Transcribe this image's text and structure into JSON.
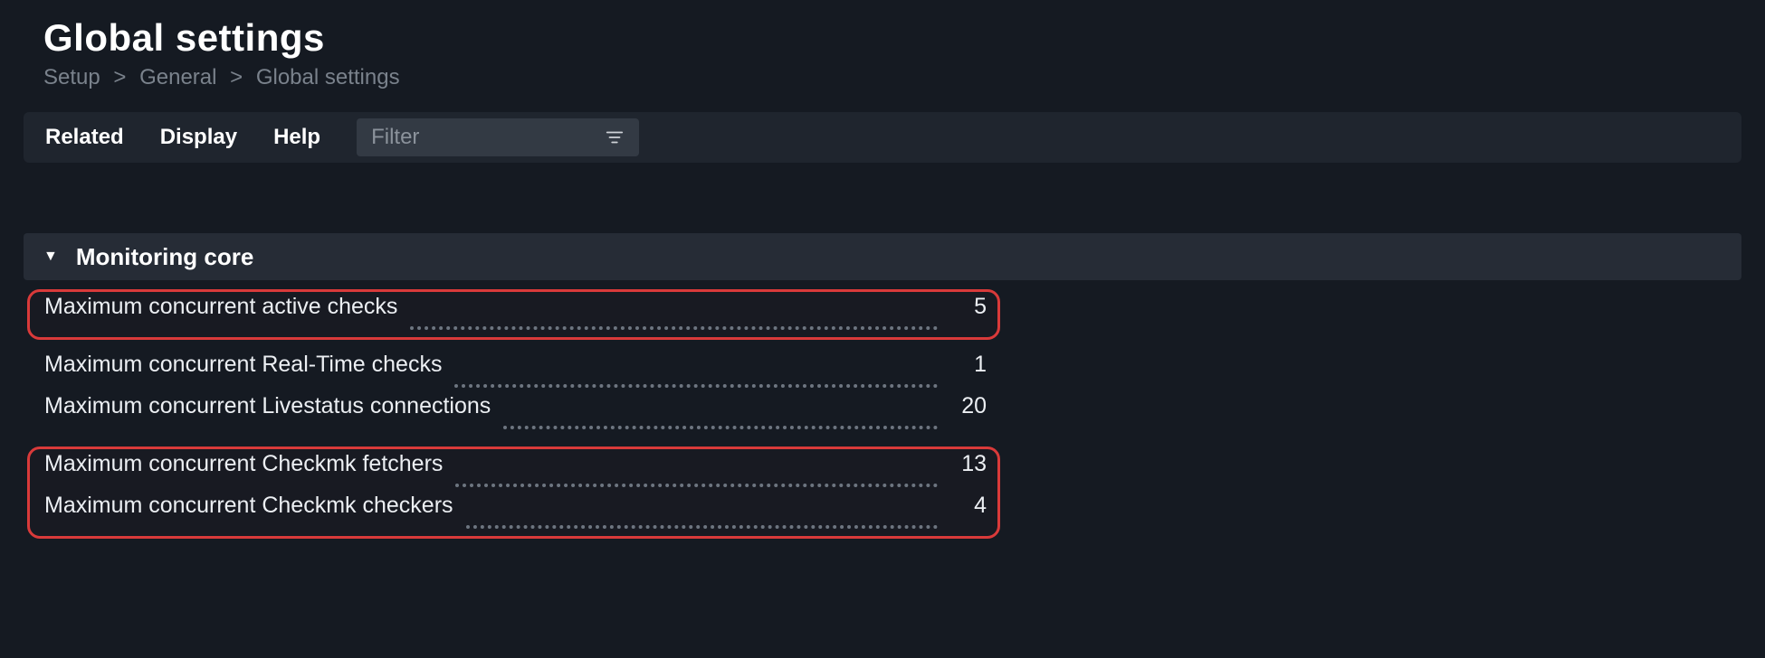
{
  "page": {
    "title": "Global settings",
    "breadcrumb": [
      "Setup",
      "General",
      "Global settings"
    ]
  },
  "toolbar": {
    "menu": {
      "related": "Related",
      "display": "Display",
      "help": "Help"
    },
    "filter": {
      "placeholder": "Filter"
    }
  },
  "section": {
    "title": "Monitoring core",
    "expanded": true,
    "groups": [
      {
        "highlight": true,
        "rows": [
          {
            "label": "Maximum concurrent active checks",
            "value": "5"
          }
        ]
      },
      {
        "highlight": false,
        "rows": [
          {
            "label": "Maximum concurrent Real-Time checks",
            "value": "1"
          },
          {
            "label": "Maximum concurrent Livestatus connections",
            "value": "20"
          }
        ]
      },
      {
        "highlight": true,
        "rows": [
          {
            "label": "Maximum concurrent Checkmk fetchers",
            "value": "13"
          },
          {
            "label": "Maximum concurrent Checkmk checkers",
            "value": "4"
          }
        ]
      }
    ]
  }
}
